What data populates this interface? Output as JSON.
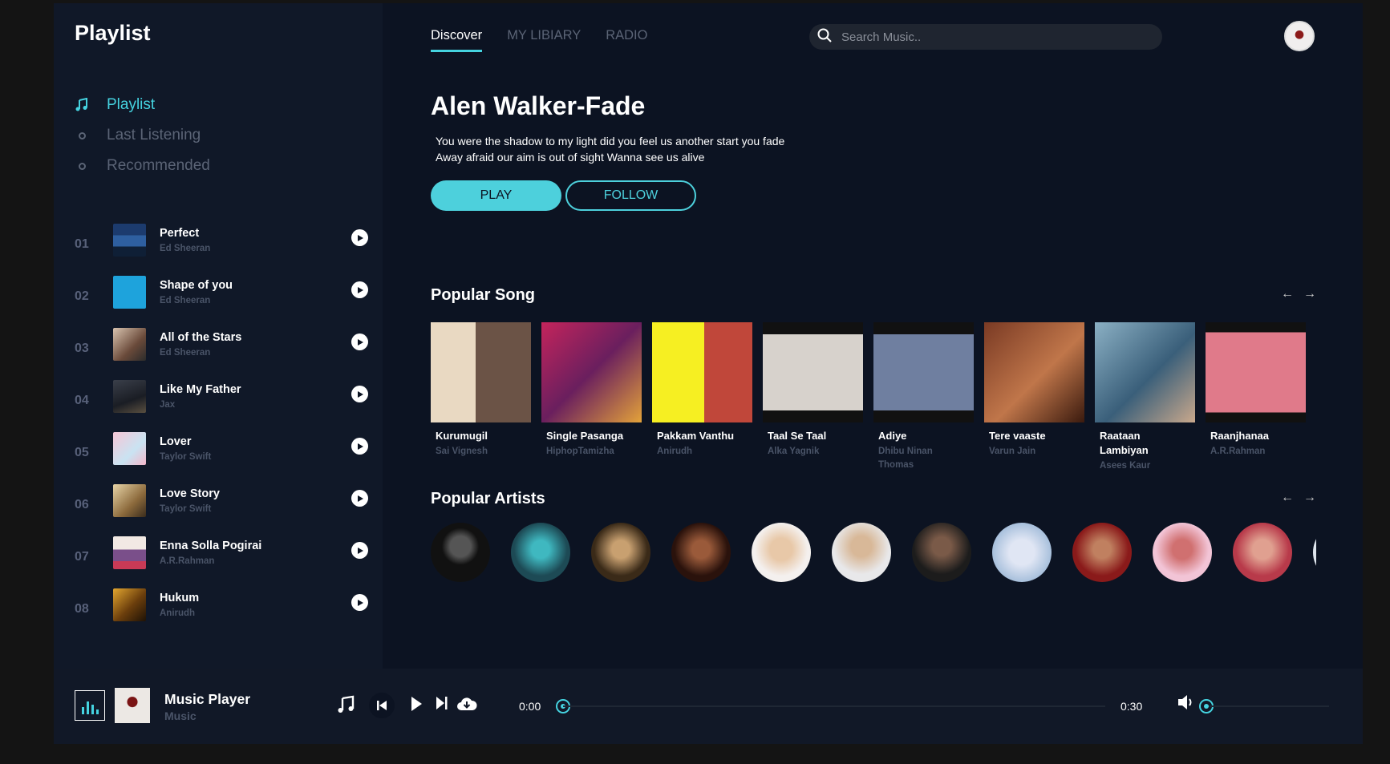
{
  "sidebar": {
    "title": "Playlist",
    "nav": [
      {
        "label": "Playlist",
        "active": true
      },
      {
        "label": "Last Listening",
        "active": false
      },
      {
        "label": "Recommended",
        "active": false
      }
    ],
    "songs": [
      {
        "num": "01",
        "name": "Perfect",
        "artist": "Ed Sheeran"
      },
      {
        "num": "02",
        "name": "Shape of you",
        "artist": "Ed Sheeran"
      },
      {
        "num": "03",
        "name": "All of the Stars",
        "artist": "Ed Sheeran"
      },
      {
        "num": "04",
        "name": "Like My Father",
        "artist": "Jax"
      },
      {
        "num": "05",
        "name": "Lover",
        "artist": "Taylor Swift"
      },
      {
        "num": "06",
        "name": "Love Story",
        "artist": "Taylor Swift"
      },
      {
        "num": "07",
        "name": "Enna Solla Pogirai",
        "artist": "A.R.Rahman"
      },
      {
        "num": "08",
        "name": "Hukum",
        "artist": "Anirudh"
      }
    ]
  },
  "header": {
    "tabs": [
      "Discover",
      "MY LIBIARY",
      "RADIO"
    ],
    "search_placeholder": "Search Music.."
  },
  "hero": {
    "title": "Alen Walker-Fade",
    "line1": "You were the shadow to my light did you feel us another start you fade",
    "line2": "Away afraid our aim is out of sight Wanna see us alive",
    "play_label": "PLAY",
    "follow_label": "FOLLOW"
  },
  "popular_songs": {
    "title": "Popular Song",
    "items": [
      {
        "title": "Kurumugil",
        "artist": "Sai Vignesh"
      },
      {
        "title": "Single Pasanga",
        "artist": "HiphopTamizha"
      },
      {
        "title": "Pakkam Vanthu",
        "artist": "Anirudh"
      },
      {
        "title": "Taal Se Taal",
        "artist": "Alka Yagnik"
      },
      {
        "title": "Adiye",
        "artist": "Dhibu Ninan Thomas"
      },
      {
        "title": "Tere vaaste",
        "artist": "Varun Jain"
      },
      {
        "title": "Raataan Lambiyan",
        "artist": "Asees Kaur"
      },
      {
        "title": "Raanjhanaa",
        "artist": "A.R.Rahman"
      }
    ]
  },
  "popular_artists": {
    "title": "Popular Artists",
    "count": 11
  },
  "player": {
    "title": "Music Player",
    "subtitle": "Music",
    "current_time": "0:00",
    "end_time": "0:30",
    "progress": 0,
    "volume": 0
  },
  "colors": {
    "accent": "#45d3e0",
    "background": "#0c1322",
    "sidebar": "#101828"
  }
}
